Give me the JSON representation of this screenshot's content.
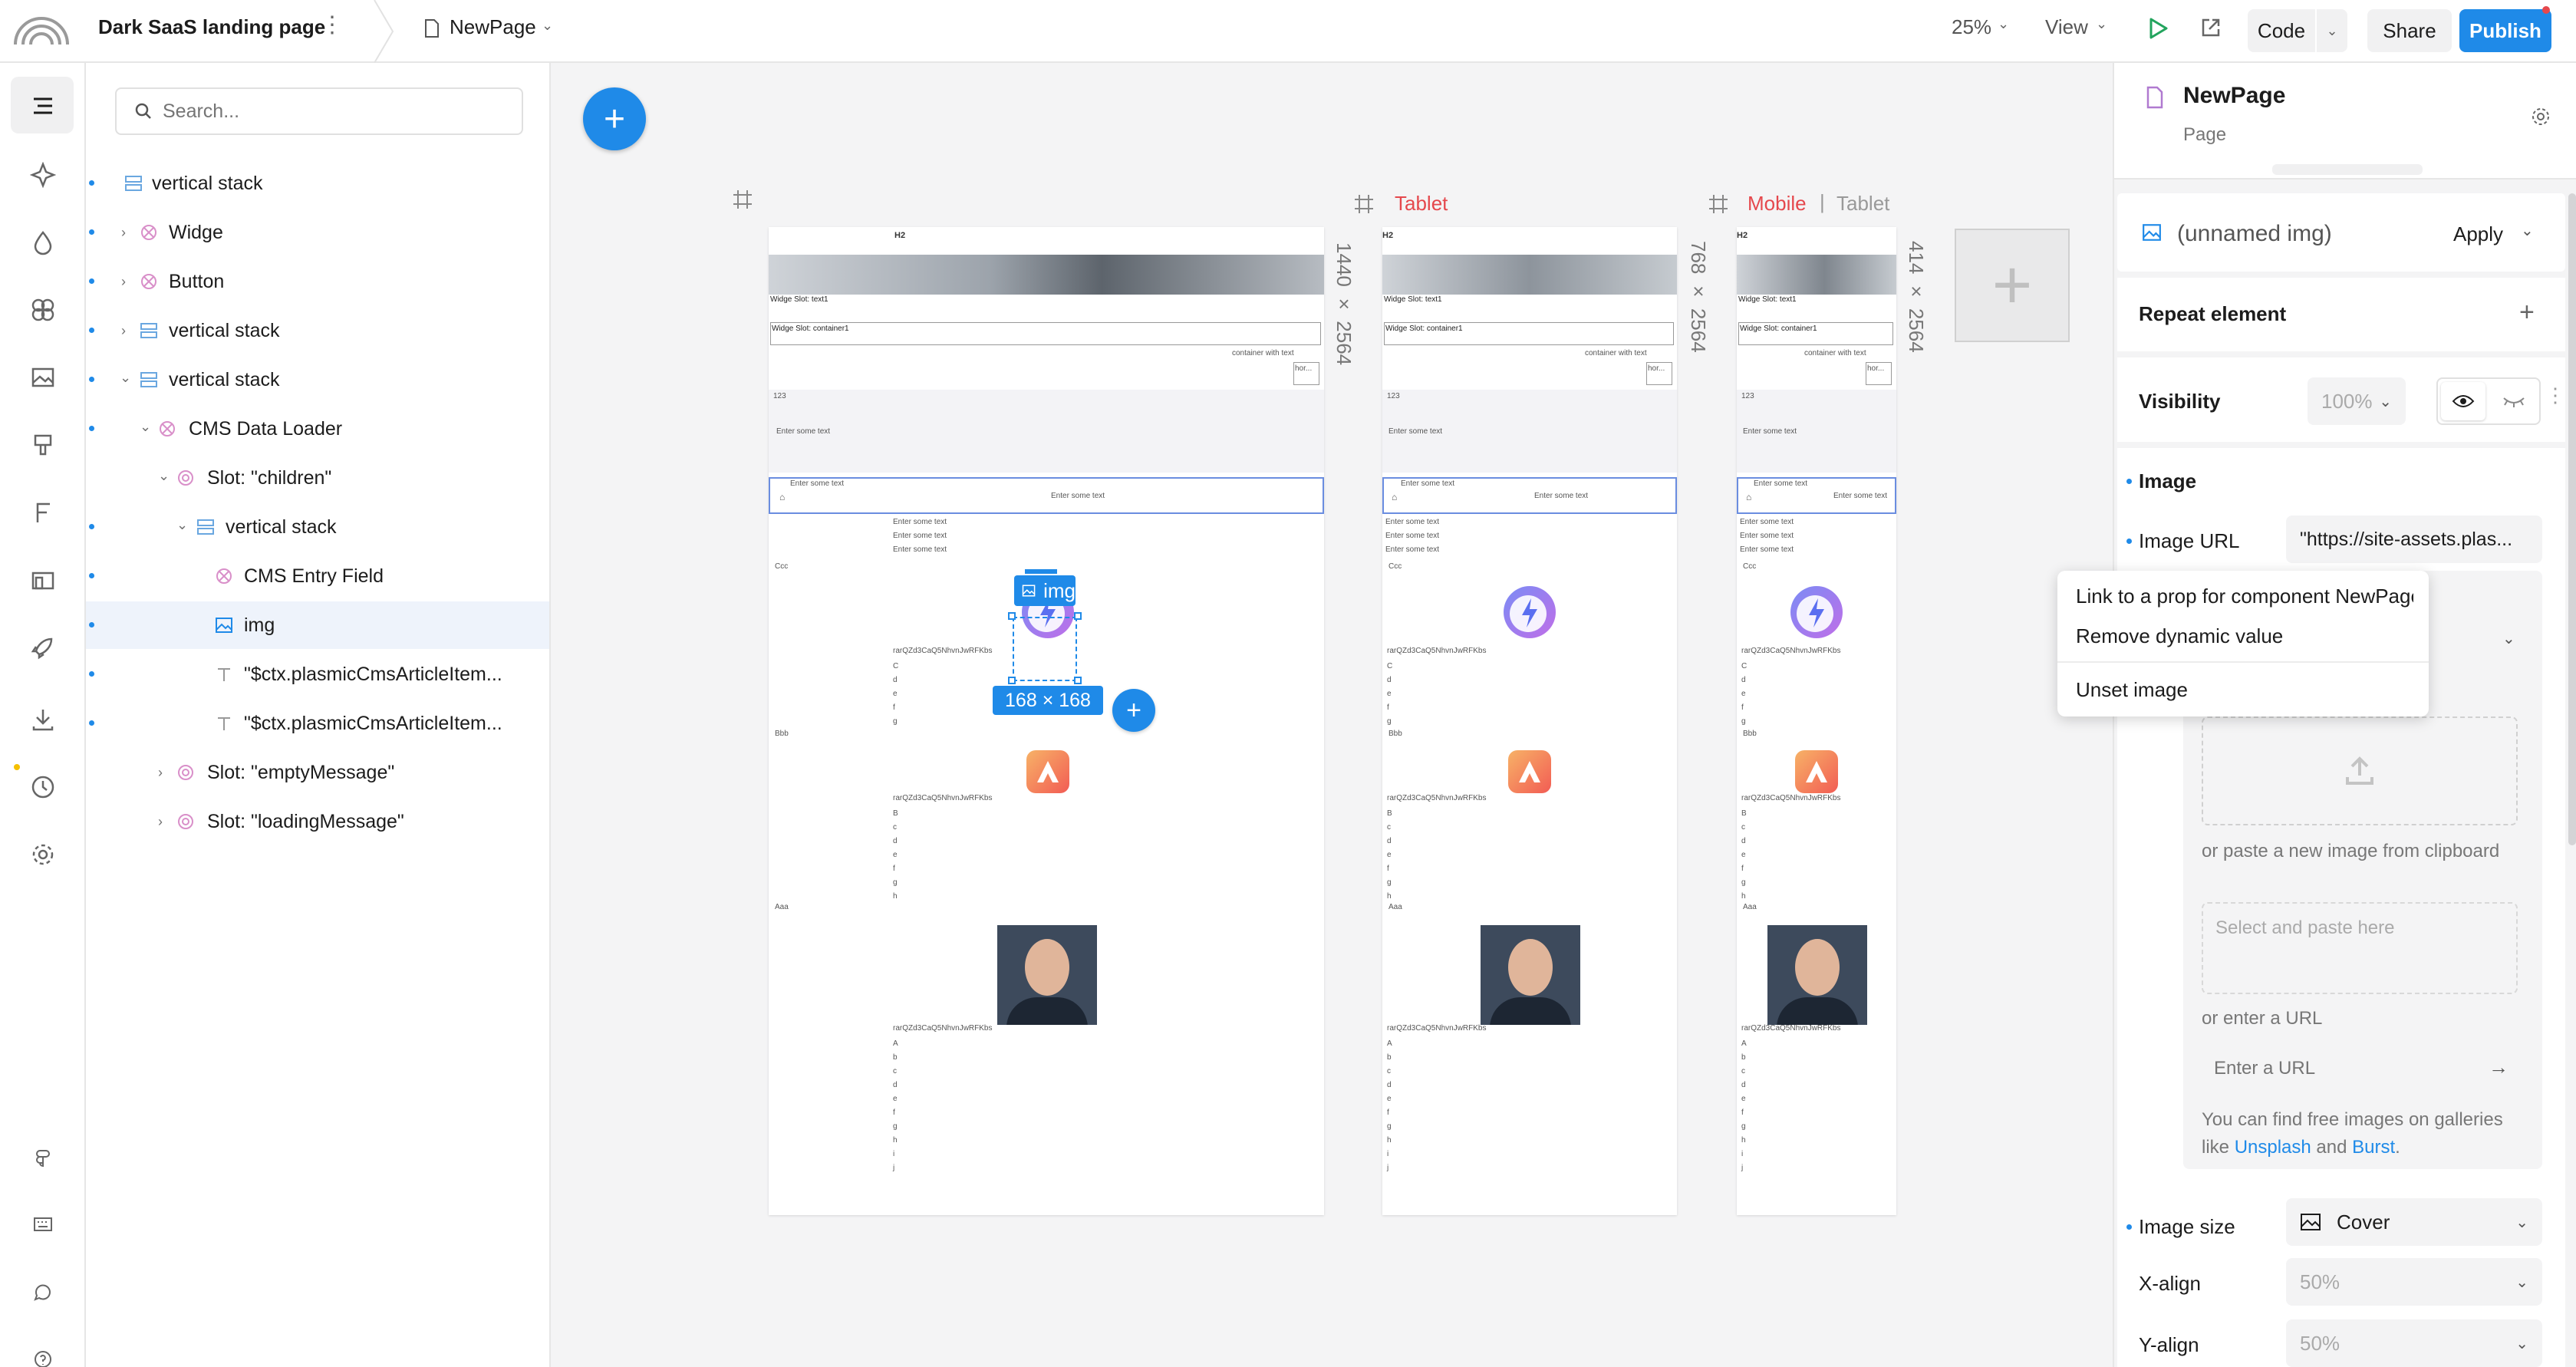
{
  "topbar": {
    "project_name": "Dark SaaS landing page",
    "page_name": "NewPage",
    "zoom": "25%",
    "view_label": "View",
    "code_label": "Code",
    "share_label": "Share",
    "publish_label": "Publish"
  },
  "search": {
    "placeholder": "Search..."
  },
  "tree": [
    {
      "label": "vertical stack",
      "icon": "stack-icon"
    },
    {
      "label": "Widge",
      "icon": "component-icon"
    },
    {
      "label": "Button",
      "icon": "component-icon"
    },
    {
      "label": "vertical stack",
      "icon": "stack-icon"
    },
    {
      "label": "vertical stack",
      "icon": "stack-icon"
    },
    {
      "label": "CMS Data Loader",
      "icon": "component-icon"
    },
    {
      "label": "Slot: \"children\"",
      "icon": "slot-icon"
    },
    {
      "label": "vertical stack",
      "icon": "stack-icon"
    },
    {
      "label": "CMS Entry Field",
      "icon": "component-icon"
    },
    {
      "label": "img",
      "icon": "image-icon"
    },
    {
      "label": "\"$ctx.plasmicCmsArticleItem...",
      "icon": "text-icon"
    },
    {
      "label": "\"$ctx.plasmicCmsArticleItem...",
      "icon": "text-icon"
    },
    {
      "label": "Slot: \"emptyMessage\"",
      "icon": "slot-icon"
    },
    {
      "label": "Slot: \"loadingMessage\"",
      "icon": "slot-icon"
    }
  ],
  "canvas": {
    "frames": [
      {
        "size": "1440 × 2564",
        "label": ""
      },
      {
        "size": "768 × 2564",
        "label": "Tablet"
      },
      {
        "size": "414 × 2564",
        "label_active": "Mobile",
        "label_sep": "|",
        "label_other": "Tablet"
      }
    ],
    "content": {
      "h2": "H2",
      "widge_text": "Widge Slot: text1",
      "widge_container": "Widge Slot: container1",
      "container_with_text": "container with text",
      "hor": "hor...",
      "num_123": "123",
      "enter_text": "Enter some text",
      "cat_c": "Ccc",
      "cat_b": "Bbb",
      "cat_a": "Aaa",
      "id_string": "rarQZd3CaQ5NhvnJwRFKbs",
      "letters_c": [
        "C",
        "d",
        "e",
        "f",
        "g"
      ],
      "letters_b": [
        "B",
        "c",
        "d",
        "e",
        "f",
        "g",
        "h"
      ],
      "letters_a": [
        "A",
        "b",
        "c",
        "d",
        "e",
        "f",
        "g",
        "h",
        "i",
        "j"
      ]
    },
    "selection": {
      "tag": "img",
      "dims": "168 × 168"
    }
  },
  "right": {
    "page_name": "NewPage",
    "page_type": "Page",
    "element_name": "(unnamed img)",
    "apply_label": "Apply",
    "repeat_label": "Repeat element",
    "visibility_label": "Visibility",
    "visibility_value": "100%",
    "image_section": "Image",
    "image_url_label": "Image URL",
    "image_url_value": "\"https://site-assets.plas...",
    "paste_hint": "or paste a new image from clipboard",
    "paste_placeholder": "Select and paste here",
    "enter_url_hint": "or enter a URL",
    "enter_url_placeholder": "Enter a URL",
    "free_images_text": "You can find free images on galleries like",
    "unsplash": "Unsplash",
    "and": "and",
    "burst": "Burst",
    "period": ".",
    "image_size_label": "Image size",
    "image_size_value": "Cover",
    "xalign_label": "X-align",
    "xalign_value": "50%",
    "yalign_label": "Y-align",
    "yalign_value": "50%"
  },
  "context_menu": {
    "items": [
      "Link to a prop for component NewPage",
      "Remove dynamic value",
      "Unset image"
    ]
  },
  "colors": {
    "accent": "#1f8ae8",
    "tablet_red": "#e5484d",
    "selection_blue": "#1f8ae8"
  }
}
